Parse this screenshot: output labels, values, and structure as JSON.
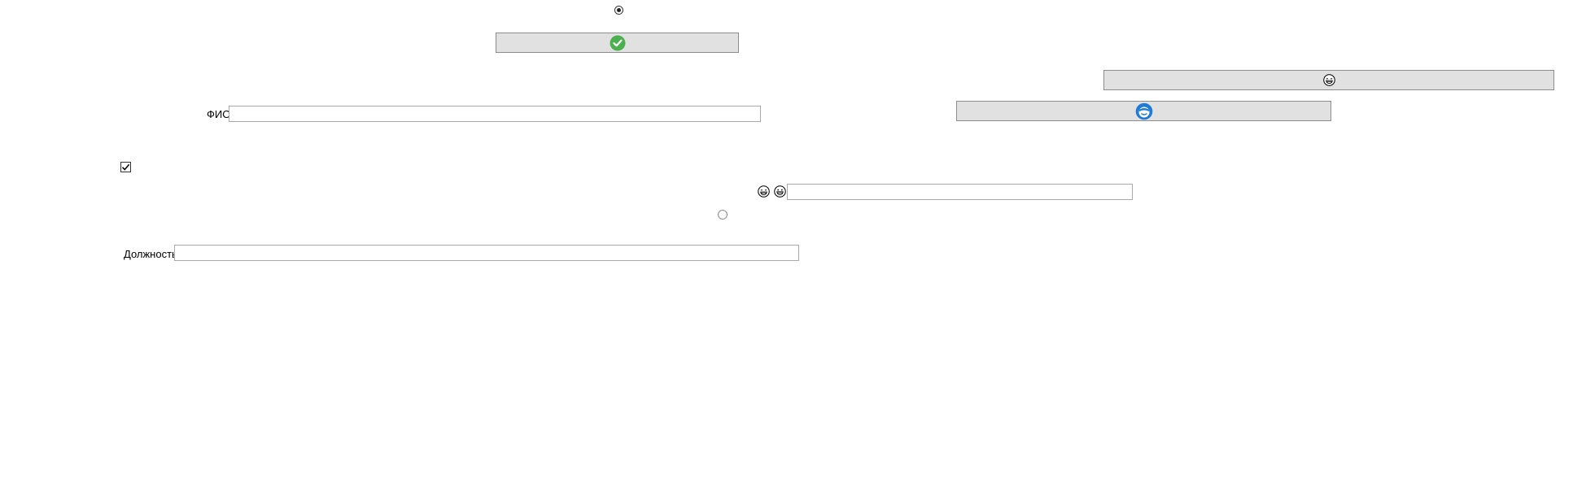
{
  "form": {
    "fio_label": "ФИО",
    "fio_value": "",
    "position_label": "Должность",
    "position_value": "",
    "emoji_field_value": "",
    "checkbox_checked": true,
    "radio_top_checked": true,
    "radio_middle_checked": false
  },
  "icons": {
    "confirm_button_icon": "green-check-circle-icon",
    "face_button_icon": "grinning-face-icon",
    "blue_face_button_icon": "blue-face-icon",
    "emoji_pair": [
      "grinning-face-icon",
      "grinning-face-icon"
    ]
  },
  "colors": {
    "button_bg": "#e1e1e1",
    "button_border": "#8c8c8c",
    "check_green": "#4caf50",
    "face_blue": "#1e7bd6"
  }
}
